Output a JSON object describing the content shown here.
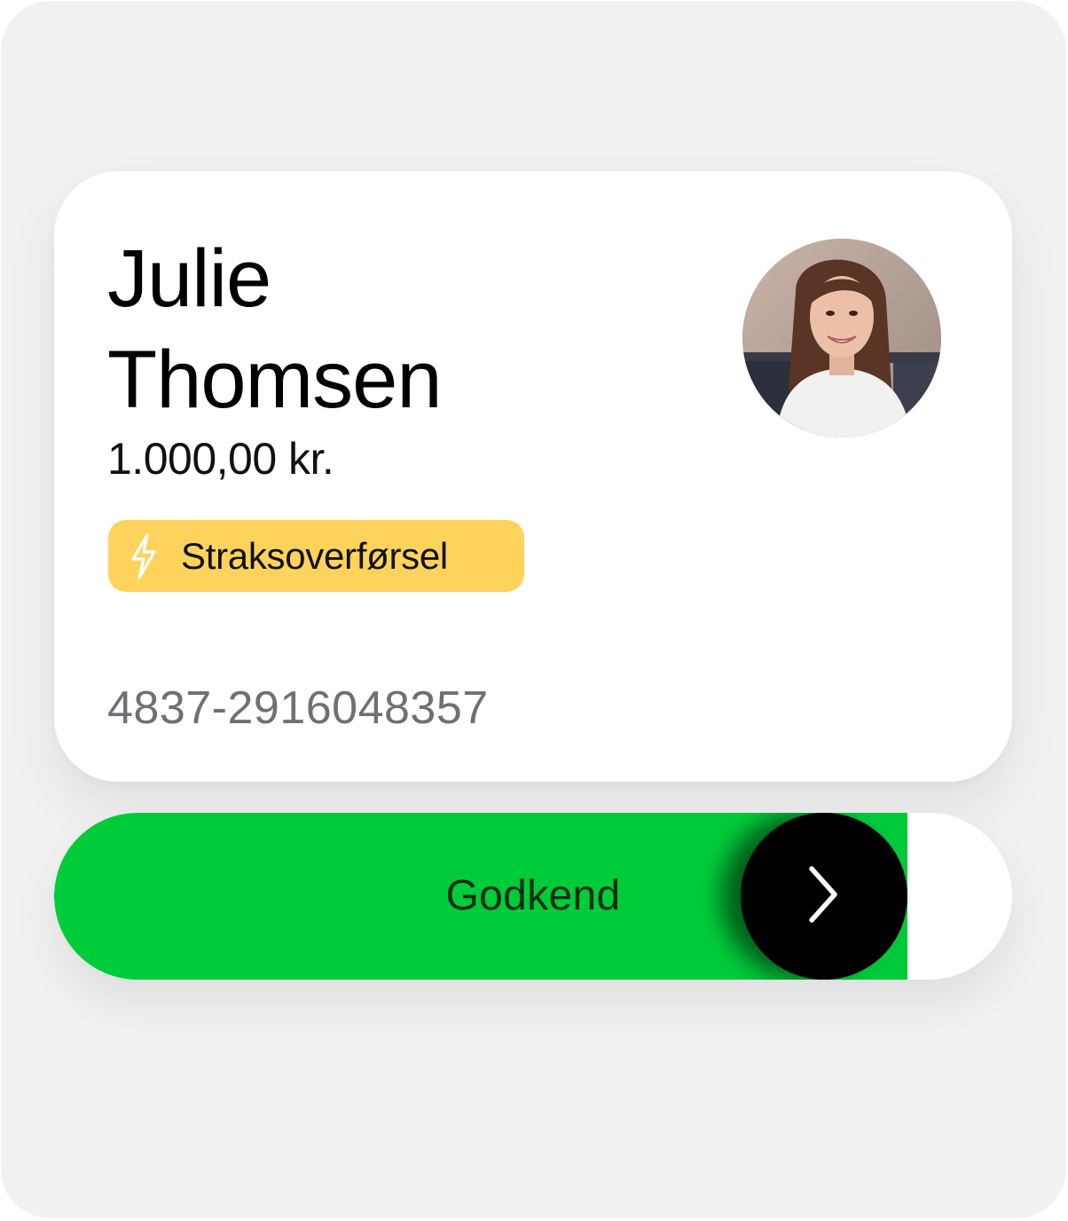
{
  "card": {
    "first_name": "Julie",
    "last_name": "Thomsen",
    "amount": "1.000,00 kr.",
    "badge": {
      "label": "Straksoverførsel",
      "icon": "lightning-icon",
      "color": "#fdd35c"
    },
    "account_number": "4837-2916048357",
    "avatar": "profile-photo"
  },
  "approve_slider": {
    "label": "Godkend",
    "knob_icon": "chevron-right-icon",
    "fill_color": "#00cc3a",
    "knob_color": "#000000"
  }
}
